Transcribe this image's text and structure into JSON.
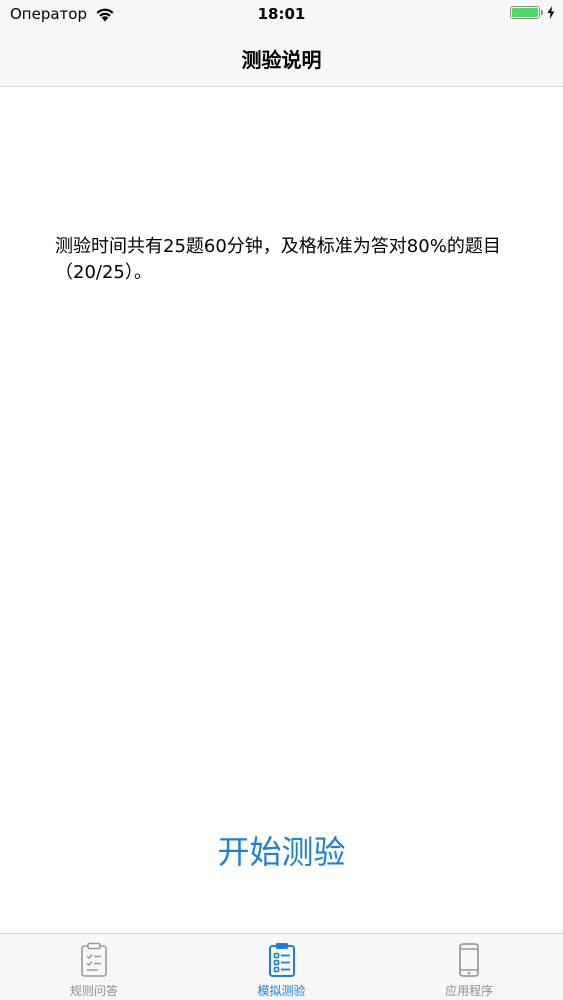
{
  "status_bar": {
    "carrier": "Оператор",
    "time": "18:01",
    "battery_level": 1.0,
    "charging": true
  },
  "nav": {
    "title": "测验说明"
  },
  "content": {
    "description": "测验时间共有25题60分钟，及格标准为答对80%的题目（20/25）。",
    "start_label": "开始测验"
  },
  "tabs": [
    {
      "label": "规则问答",
      "icon": "clipboard-checklist-icon",
      "active": false
    },
    {
      "label": "模拟测验",
      "icon": "clipboard-list-icon",
      "active": true
    },
    {
      "label": "应用程序",
      "icon": "phone-icon",
      "active": false
    }
  ],
  "colors": {
    "accent": "#1a7fd6",
    "inactive": "#8e8e8e",
    "battery": "#4cd964",
    "bar_background": "#f7f7f7"
  }
}
